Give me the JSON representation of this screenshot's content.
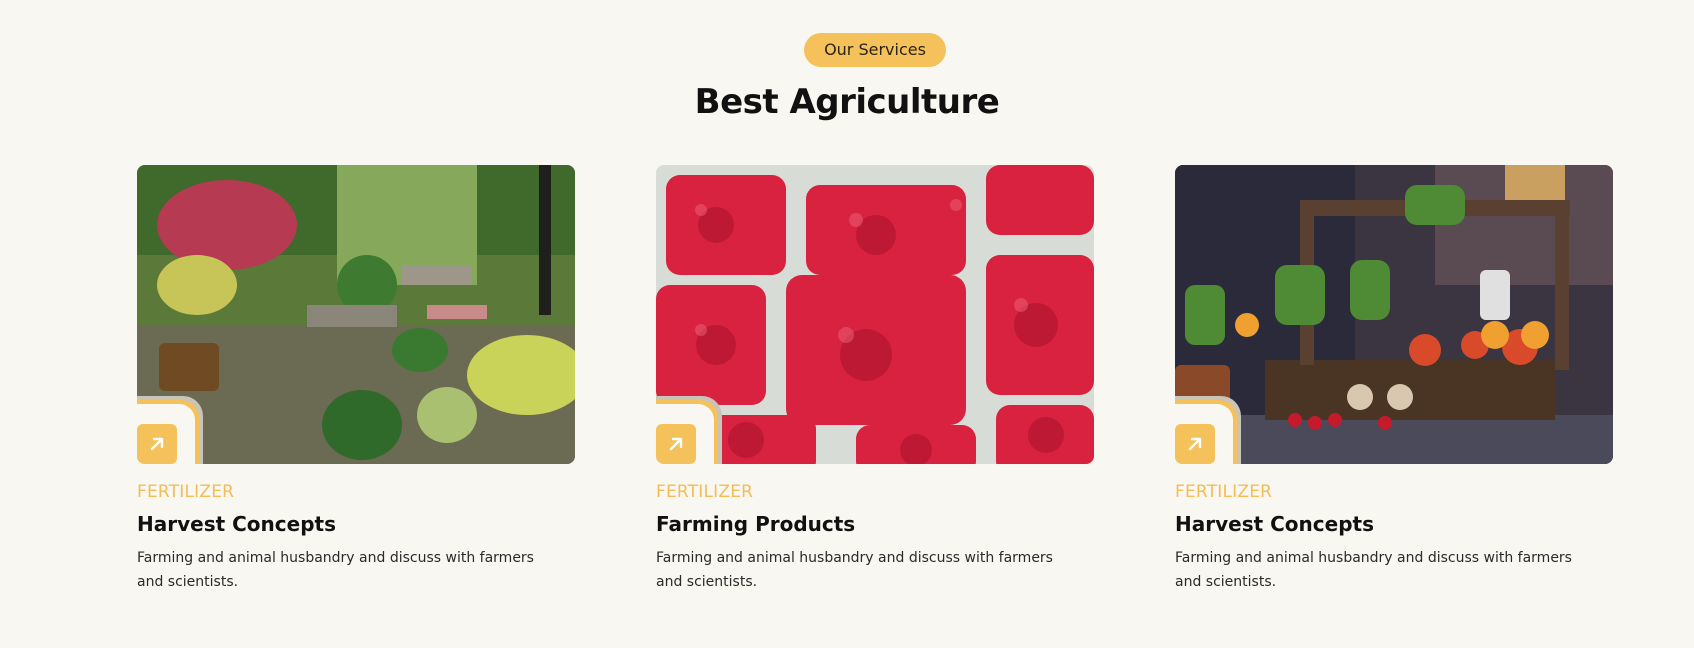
{
  "section": {
    "badge": "Our Services",
    "heading": "Best Agriculture"
  },
  "cards": [
    {
      "image": "garden-image",
      "category": "FERTILIZER",
      "title": "Harvest Concepts",
      "description": "Farming and animal husbandry and discuss with farmers and scientists.",
      "button_icon": "arrow-up-right-icon"
    },
    {
      "image": "raspberries-image",
      "category": "FERTILIZER",
      "title": "Farming Products",
      "description": "Farming and animal husbandry and discuss with farmers and scientists.",
      "button_icon": "arrow-up-right-icon"
    },
    {
      "image": "vegetable-basket-image",
      "category": "FERTILIZER",
      "title": "Harvest Concepts",
      "description": "Farming and animal husbandry and discuss with farmers and scientists.",
      "button_icon": "arrow-up-right-icon"
    }
  ],
  "colors": {
    "background": "#f9f7f2",
    "accent": "#f5c15a",
    "category": "#f2bd55",
    "heading": "#111111"
  }
}
